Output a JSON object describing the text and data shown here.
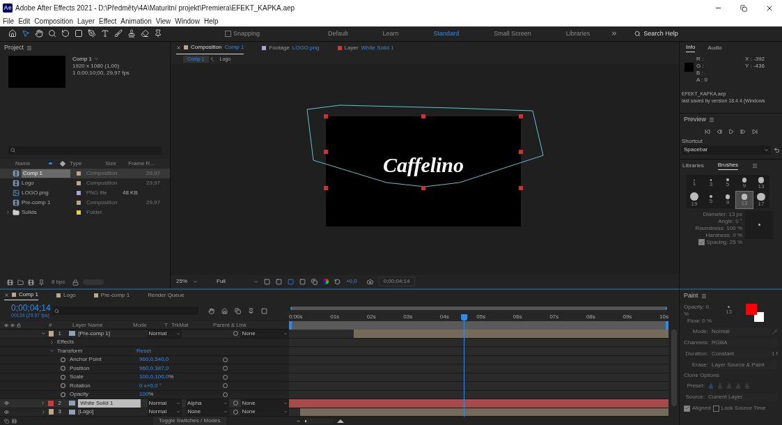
{
  "window": {
    "app_icon": "Ae",
    "title": "Adobe After Effects 2021 - D:\\Předměty\\4A\\Maturitní projekt\\Premiera\\EFEKT_KAPKA.aep"
  },
  "menu": [
    "File",
    "Edit",
    "Composition",
    "Layer",
    "Effect",
    "Animation",
    "View",
    "Window",
    "Help"
  ],
  "toolbar": {
    "snapping": {
      "label": "Snapping",
      "checked": false
    },
    "workspaces": [
      {
        "label": "Default",
        "selected": false
      },
      {
        "label": "Learn",
        "selected": false
      },
      {
        "label": "Standard",
        "selected": true
      },
      {
        "label": "Small Screen",
        "selected": false
      },
      {
        "label": "Libraries",
        "selected": false
      }
    ],
    "search_placeholder": "Search Help"
  },
  "project": {
    "title": "Project",
    "comp_name": "Comp 1",
    "comp_info": [
      "1920 x 1080 (1,00)",
      "1 0;00;10;00, 29,97 fps"
    ],
    "columns": [
      "Name",
      "Type",
      "Size",
      "Frame R..."
    ],
    "items": [
      {
        "kind": "comp",
        "name": "Comp 1",
        "type": "Composition",
        "frame_rate": "29,97",
        "color": "#b9a98a",
        "selected": true
      },
      {
        "kind": "comp",
        "name": "Logo",
        "type": "Composition",
        "frame_rate": "29,97",
        "color": "#b9a98a",
        "selected": false
      },
      {
        "kind": "image",
        "name": "LOGO.png",
        "type": "PNG file",
        "size": "48 KB",
        "color": "#aaa4d8",
        "selected": false
      },
      {
        "kind": "comp",
        "name": "Pre-comp 1",
        "type": "Composition",
        "frame_rate": "29,97",
        "color": "#b9a98a",
        "selected": false
      },
      {
        "kind": "folder",
        "name": "Solids",
        "type": "Folder",
        "color": "#e3d24b",
        "selected": false
      }
    ],
    "bpc": "8 bpc",
    "thumbnail_slider": {
      "level": 1
    }
  },
  "composition": {
    "tabs": [
      {
        "prefix": "Composition",
        "name": "Comp 1",
        "color": "#b9a98a",
        "selected": true
      },
      {
        "prefix": "Footage",
        "name": "LOGO.png",
        "color": "#aaa4d8",
        "selected": false
      },
      {
        "prefix": "Layer",
        "name": "White Solid 1",
        "color": "#d23a3a",
        "selected": false
      }
    ],
    "breadcrumbs": [
      {
        "label": "Comp 1",
        "selected": true
      },
      {
        "label": "Logo",
        "selected": false
      }
    ],
    "logo_text": "Caffelino",
    "zoom": "25%",
    "resolution": "Full",
    "exposure": "+0,0",
    "timecode": "0;00;04;14"
  },
  "info": {
    "tabs": [
      {
        "label": "Info",
        "selected": true
      },
      {
        "label": "Audio",
        "selected": false
      }
    ],
    "channels": [
      "R :",
      "G :",
      "B :",
      "A : 0"
    ],
    "x": "X : -392",
    "y": "Y : -436",
    "file": "EFEKT_KAPKA.aep",
    "saved": "last saved by version 18.4.4 (Windows"
  },
  "preview": {
    "title": "Preview",
    "shortcut_label": "Shortcut",
    "shortcut": "Spacebar"
  },
  "brushes": {
    "tabs": [
      {
        "label": "Libraries",
        "selected": false
      },
      {
        "label": "Brushes",
        "selected": true
      }
    ],
    "sizes": [
      {
        "label": "1",
        "selected": false
      },
      {
        "label": "3",
        "selected": false
      },
      {
        "label": "5",
        "selected": false
      },
      {
        "label": "9",
        "selected": false
      },
      {
        "label": "13",
        "selected": false
      },
      {
        "label": "19",
        "selected": false
      },
      {
        "label": "5",
        "selected": false
      },
      {
        "label": "9",
        "selected": false
      },
      {
        "label": "13",
        "selected": true
      },
      {
        "label": "17",
        "selected": false
      }
    ],
    "params": [
      "Diameter: 13 px",
      "Angle: 0 °",
      "Roundness: 100 %",
      "Hardness: 0 %"
    ],
    "spacing": {
      "label": "Spacing: 25 %",
      "checked": true
    }
  },
  "timeline": {
    "tabs": [
      {
        "label": "Comp 1",
        "color": "#b9a98a",
        "selected": true
      },
      {
        "label": "Logo",
        "color": "#b9a98a",
        "selected": false
      },
      {
        "label": "Pre-comp 1",
        "color": "#b9a98a",
        "selected": false
      },
      {
        "label": "Render Queue",
        "selected": false
      }
    ],
    "timecode": "0;00;04;14",
    "frame_info": "00134 (29.97 fps)",
    "columns": [
      "#",
      "Layer Name",
      "Mode",
      "T",
      "TrkMat",
      "Parent & Link"
    ],
    "rows": [
      {
        "kind": "layer",
        "number": "1",
        "name": "[Pre-comp 1]",
        "mode": "Normal",
        "parent": "None",
        "color": "#b9a98a",
        "visible": false,
        "expanded": true,
        "selected": false,
        "bar": {
          "color": "#766b59",
          "level": 0.83
        }
      },
      {
        "kind": "group",
        "label": "Effects",
        "expanded": false
      },
      {
        "kind": "group",
        "label": "Transform",
        "expanded": true,
        "value": "Reset"
      },
      {
        "kind": "property",
        "label": "Anchor Point",
        "value": "960,0,540,0"
      },
      {
        "kind": "property",
        "label": "Position",
        "value": "960,0,387,0"
      },
      {
        "kind": "property",
        "label": "Scale",
        "value": "100,0,100,0",
        "unit": "%"
      },
      {
        "kind": "property",
        "label": "Rotation",
        "value": "0 x+0,0 °"
      },
      {
        "kind": "property",
        "label": "Opacity",
        "value": "100",
        "unit": "%"
      },
      {
        "kind": "layer",
        "number": "2",
        "name": "White Solid 1",
        "mode": "Normal",
        "trkmat": "Alpha",
        "parent": "None",
        "color": "#d23a3a",
        "visible": true,
        "expanded": false,
        "selected": true,
        "bar": {
          "color": "#a84a4a",
          "level": 1
        }
      },
      {
        "kind": "layer",
        "number": "3",
        "name": "[Logo]",
        "mode": "Normal",
        "trkmat": "None",
        "parent": "None",
        "color": "#b9a98a",
        "visible": true,
        "expanded": false,
        "selected": false,
        "bar": {
          "color": "#766b59",
          "level": 0.97
        }
      }
    ],
    "ruler": [
      "0:00s",
      "01s",
      "02s",
      "03s",
      "04s",
      "05s",
      "06s",
      "07s",
      "08s",
      "09s",
      "10s"
    ],
    "playhead": {
      "level": 0.46
    },
    "zoom_slider": {
      "level": 0.05
    },
    "footer": "Toggle Switches / Modes"
  },
  "paint": {
    "title": "Paint",
    "opacity": "Opacity: 0 %",
    "flow": "Flow: 0 %",
    "brush_size": "13",
    "fields": [
      {
        "label": "Mode:",
        "value": "Normal"
      },
      {
        "label": "Channels:",
        "value": "RGBA"
      },
      {
        "label": "Duration:",
        "value": "Constant"
      },
      {
        "label": "Erase:",
        "value": "Layer Source & Paint"
      }
    ],
    "frames": "1 f",
    "clone_title": "Clone Options",
    "preset_label": "Preset:",
    "source_label": "Source:",
    "source": "Current Layer",
    "aligned": {
      "label": "Aligned",
      "checked": true
    },
    "lock": {
      "label": "Lock Source Time",
      "checked": false
    },
    "swatches": [
      {
        "kind": "background",
        "color": "#ffffff"
      },
      {
        "kind": "foreground",
        "color": "#ff0000"
      }
    ]
  }
}
